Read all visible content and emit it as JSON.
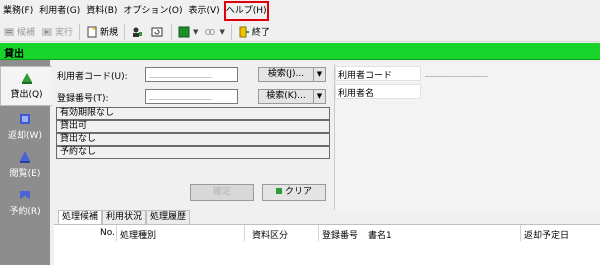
{
  "menu": [
    {
      "label": "業務(F)"
    },
    {
      "label": "利用者(G)"
    },
    {
      "label": "資料(B)"
    },
    {
      "label": "オプション(O)"
    },
    {
      "label": "表示(V)"
    },
    {
      "label": "ヘルプ(H)",
      "highlighted": true
    }
  ],
  "toolbar": {
    "candidate_label": "候補",
    "execute_label": "実行",
    "new_label": "新規",
    "exit_label": "終了"
  },
  "title": "貸出",
  "nav": [
    {
      "label": "貸出(Q)",
      "icon": "lend-icon",
      "active": true
    },
    {
      "label": "返却(W)",
      "icon": "return-icon"
    },
    {
      "label": "閲覧(E)",
      "icon": "browse-icon"
    },
    {
      "label": "予約(R)",
      "icon": "reserve-icon"
    }
  ],
  "form": {
    "user_code_label": "利用者コード(U):",
    "user_code_value": "_____________",
    "search1_label": "検索(J)...",
    "reg_no_label": "登録番号(T):",
    "reg_no_value": "_____________",
    "search2_label": "検索(K)...",
    "status_list": [
      "有効期限なし",
      "貸出可",
      "貸出なし",
      "予約なし"
    ],
    "execute_button": "確定",
    "clear_button": "クリア"
  },
  "info": {
    "user_code_label": "利用者コード",
    "user_code_value": "_____________",
    "user_name_label": "利用者名"
  },
  "tabs": [
    "処理候補",
    "利用状況",
    "処理履歴"
  ],
  "grid_headers": {
    "no": "No.",
    "type": "処理種別",
    "category": "資料区分",
    "reg_no": "登録番号",
    "title": "書名1",
    "due": "返却予定日"
  },
  "colors": {
    "title_bar": "#19d42a",
    "nav_bg": "#8d8d8d",
    "highlight": "#e0000b"
  }
}
